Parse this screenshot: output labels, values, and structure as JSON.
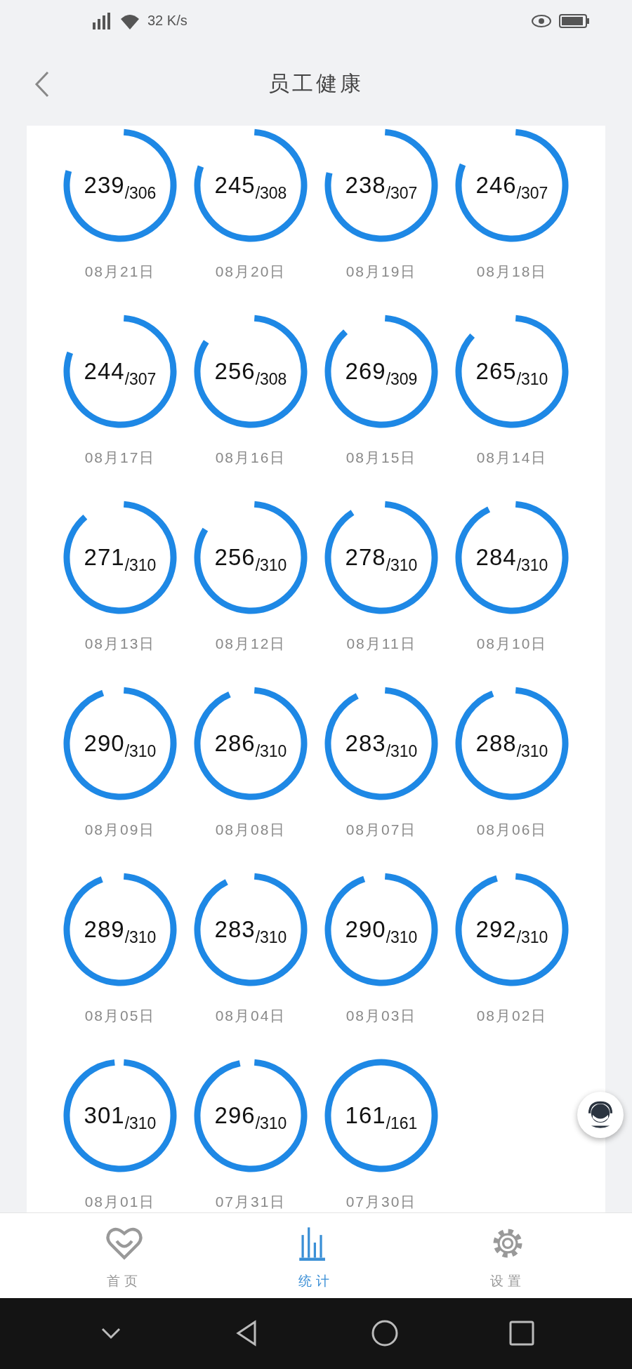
{
  "status_bar": {
    "net_speed": "32 K/s"
  },
  "header": {
    "title": "员工健康"
  },
  "records": [
    {
      "value": "239",
      "total": "/306",
      "date": "08月21日"
    },
    {
      "value": "245",
      "total": "/308",
      "date": "08月20日"
    },
    {
      "value": "238",
      "total": "/307",
      "date": "08月19日"
    },
    {
      "value": "246",
      "total": "/307",
      "date": "08月18日"
    },
    {
      "value": "244",
      "total": "/307",
      "date": "08月17日"
    },
    {
      "value": "256",
      "total": "/308",
      "date": "08月16日"
    },
    {
      "value": "269",
      "total": "/309",
      "date": "08月15日"
    },
    {
      "value": "265",
      "total": "/310",
      "date": "08月14日"
    },
    {
      "value": "271",
      "total": "/310",
      "date": "08月13日"
    },
    {
      "value": "256",
      "total": "/310",
      "date": "08月12日"
    },
    {
      "value": "278",
      "total": "/310",
      "date": "08月11日"
    },
    {
      "value": "284",
      "total": "/310",
      "date": "08月10日"
    },
    {
      "value": "290",
      "total": "/310",
      "date": "08月09日"
    },
    {
      "value": "286",
      "total": "/310",
      "date": "08月08日"
    },
    {
      "value": "283",
      "total": "/310",
      "date": "08月07日"
    },
    {
      "value": "288",
      "total": "/310",
      "date": "08月06日"
    },
    {
      "value": "289",
      "total": "/310",
      "date": "08月05日"
    },
    {
      "value": "283",
      "total": "/310",
      "date": "08月04日"
    },
    {
      "value": "290",
      "total": "/310",
      "date": "08月03日"
    },
    {
      "value": "292",
      "total": "/310",
      "date": "08月02日"
    },
    {
      "value": "301",
      "total": "/310",
      "date": "08月01日"
    },
    {
      "value": "296",
      "total": "/310",
      "date": "07月31日"
    },
    {
      "value": "161",
      "total": "/161",
      "date": "07月30日"
    }
  ],
  "tab_bar": [
    {
      "label": "首页",
      "kind": "home",
      "selected": false
    },
    {
      "label": "统计",
      "kind": "stats",
      "selected": true
    },
    {
      "label": "设置",
      "kind": "settings",
      "selected": false
    }
  ]
}
